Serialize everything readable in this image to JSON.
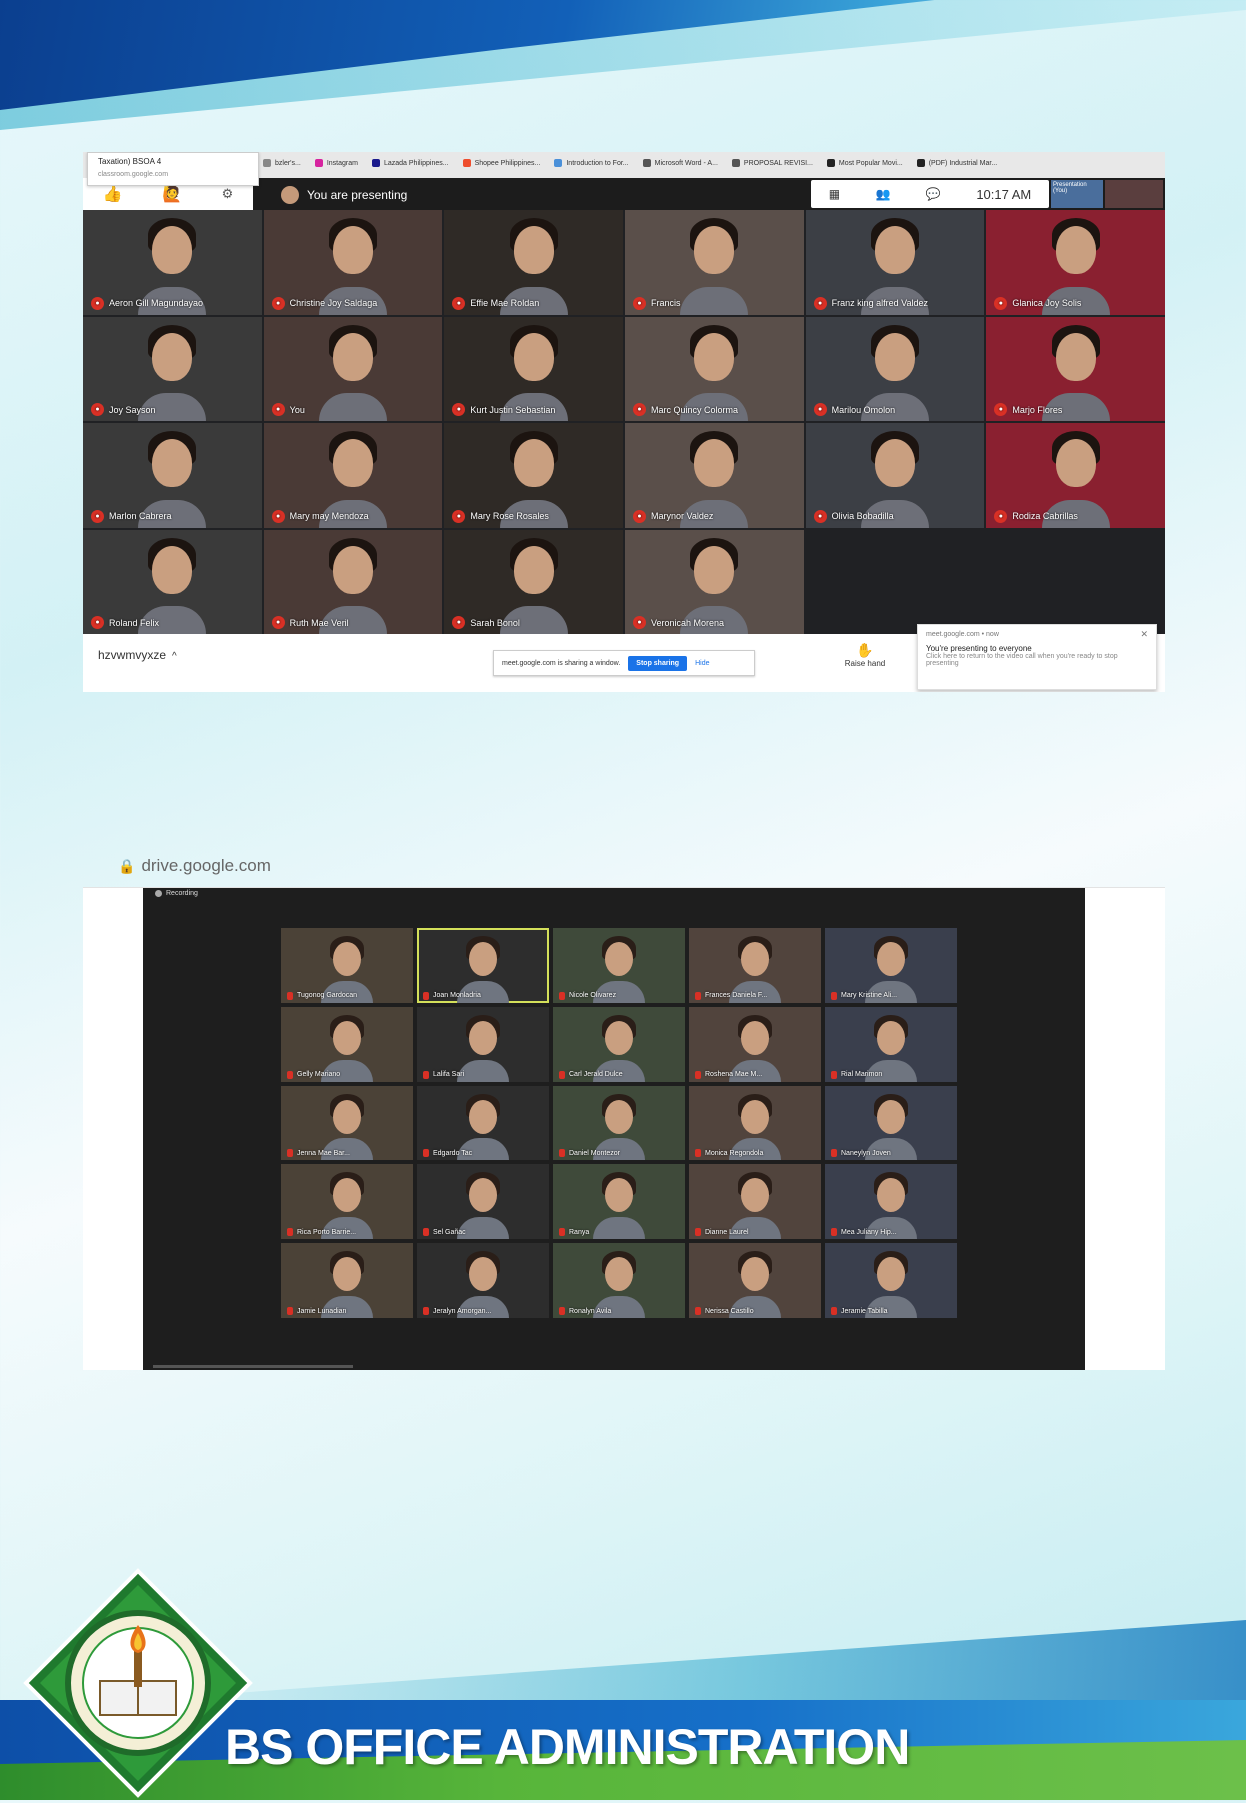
{
  "footer": {
    "program": "BS OFFICE ADMINISTRATION"
  },
  "meet": {
    "tab_tooltip": {
      "title": "Taxation) BSOA 4",
      "url": "classroom.google.com"
    },
    "bookmarks": [
      {
        "label": "bzler's...",
        "color": "#888888"
      },
      {
        "label": "Instagram",
        "color": "#d6249f"
      },
      {
        "label": "Lazada Philippines...",
        "color": "#1a1a8c"
      },
      {
        "label": "Shopee Philippines...",
        "color": "#ee4d2d"
      },
      {
        "label": "Introduction to For...",
        "color": "#4a90d9"
      },
      {
        "label": "Microsoft Word - A...",
        "color": "#555555"
      },
      {
        "label": "PROPOSAL REVISI...",
        "color": "#555555"
      },
      {
        "label": "Most Popular Movi...",
        "color": "#222222"
      },
      {
        "label": "(PDF) Industrial Mar...",
        "color": "#222222"
      }
    ],
    "reactions": [
      "👍",
      "🙋",
      "⚙"
    ],
    "presenting_label": "You are presenting",
    "time": "10:17 AM",
    "controls": [
      "▦",
      "👥",
      "💬"
    ],
    "self_tile_label": "Presentation (You)",
    "participants": [
      {
        "name": "Aeron Gill Magundayao"
      },
      {
        "name": "Christine Joy Saldaga"
      },
      {
        "name": "Effie Mae Roldan"
      },
      {
        "name": "Francis"
      },
      {
        "name": "Franz king alfred Valdez"
      },
      {
        "name": "Glanica Joy Solis"
      },
      {
        "name": "Joy Sayson"
      },
      {
        "name": "You"
      },
      {
        "name": "Kurt Justin Sebastian"
      },
      {
        "name": "Marc Quincy Colorma"
      },
      {
        "name": "Marilou Omolon"
      },
      {
        "name": "Marjo Flores"
      },
      {
        "name": "Marlon Cabrera"
      },
      {
        "name": "Mary may Mendoza"
      },
      {
        "name": "Mary Rose Rosales"
      },
      {
        "name": "Marynor Valdez"
      },
      {
        "name": "Olivia Bobadilla"
      },
      {
        "name": "Rodiza Cabrillas"
      },
      {
        "name": "Roland Felix"
      },
      {
        "name": "Ruth Mae Veril"
      },
      {
        "name": "Sarah Bonol"
      },
      {
        "name": "Veronicah Morena"
      }
    ],
    "meeting_code": "hzvwmvyxze",
    "share_text": "meet.google.com is sharing a window.",
    "stop_sharing": "Stop sharing",
    "hide": "Hide",
    "raise_hand": "Raise hand",
    "notification": {
      "header": "meet.google.com • now",
      "title": "You're presenting to everyone",
      "body": "Click here to return to the video call when you're ready to stop presenting"
    }
  },
  "drive": {
    "url": "drive.google.com",
    "recording_label": "Recording",
    "participants": [
      {
        "name": "Tugonog Gardocan"
      },
      {
        "name": "Joan Monladria"
      },
      {
        "name": "Nicole Olivarez"
      },
      {
        "name": "Frances Daniela F..."
      },
      {
        "name": "Mary Kristine Ali..."
      },
      {
        "name": "Gelly Mariano"
      },
      {
        "name": "Lalifa Sari"
      },
      {
        "name": "Carl Jerald Dulce"
      },
      {
        "name": "Roshena Mae M..."
      },
      {
        "name": "Rial Marimon"
      },
      {
        "name": "Jenna Mae Bar..."
      },
      {
        "name": "Edgardo Tac"
      },
      {
        "name": "Daniel Montezor"
      },
      {
        "name": "Monica Regondola"
      },
      {
        "name": "Naneylyn Joven"
      },
      {
        "name": "Rica Porto Barrie..."
      },
      {
        "name": "Sel Gañac"
      },
      {
        "name": "Ranya"
      },
      {
        "name": "Dianne Laurel"
      },
      {
        "name": "Mea Juliany Hip..."
      },
      {
        "name": "Jamie Lunadian"
      },
      {
        "name": "Jeralyn Amorgan..."
      },
      {
        "name": "Ronalyn Avila"
      },
      {
        "name": "Nerissa Castillo"
      },
      {
        "name": "Jeramie Tabilla"
      }
    ]
  }
}
